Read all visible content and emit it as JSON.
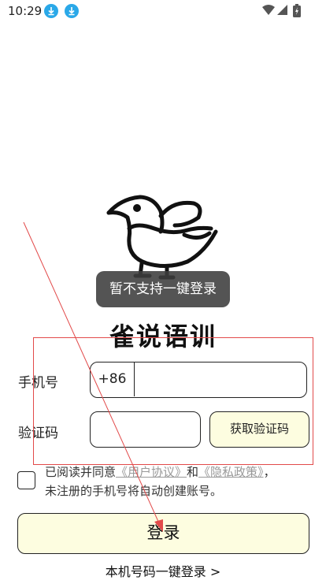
{
  "status_bar": {
    "time": "10:29",
    "icons": [
      "download-icon",
      "download-icon",
      "wifi-icon",
      "signal-icon",
      "battery-icon"
    ]
  },
  "toast": {
    "text": "暂不支持一键登录"
  },
  "app": {
    "title": "雀说语训"
  },
  "form": {
    "phone_label": "手机号",
    "country_code": "+86",
    "phone_value": "",
    "code_label": "验证码",
    "code_value": "",
    "get_code_label": "获取验证码"
  },
  "agreement": {
    "checked": false,
    "prefix": "已阅读并同意",
    "user_agreement": "《用户协议》",
    "and": "和",
    "privacy_policy": "《隐私政策》",
    "suffix": "，",
    "note": "未注册的手机号将自动创建账号。"
  },
  "login": {
    "label": "登录"
  },
  "one_click": {
    "label": "本机号码一键登录 >"
  },
  "colors": {
    "accent_fill": "#fdfde0",
    "status_icon": "#2aa8e8",
    "annotation": "#e24a4a"
  }
}
